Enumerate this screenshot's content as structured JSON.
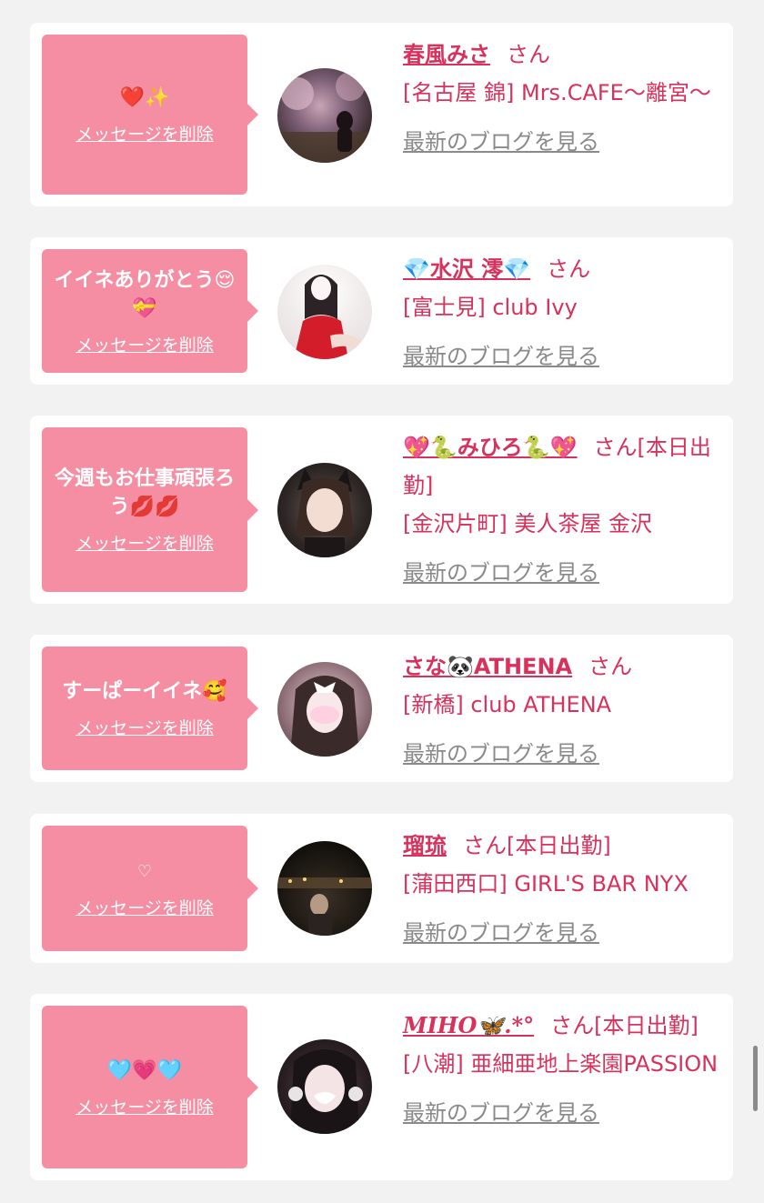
{
  "colors": {
    "page_bg": "#f2f2f2",
    "card_bg": "#ffffff",
    "bubble_bg": "#f58ea3",
    "accent": "#d8325c",
    "link_gray": "#8a8a8a"
  },
  "delete_label": "メッセージを削除",
  "blog_label": "最新のブログを見る",
  "san_label": "さん",
  "cards": [
    {
      "message": "❤️✨",
      "name": "春風みさ",
      "status": "",
      "shop": "[名古屋 錦] Mrs.CAFE～離宮～",
      "avatar_icon": "avatar-cherry-blossom-photo"
    },
    {
      "message": "イイネありがとう😌💝",
      "name": "💎水沢 澪💎",
      "status": "",
      "shop": "[富士見] club Ivy",
      "avatar_icon": "avatar-red-dress-photo"
    },
    {
      "message": "今週もお仕事頑張ろう💋💋",
      "name": "💖🐍みひろ🐍💖",
      "status": "[本日出勤]",
      "shop": "[金沢片町] 美人茶屋 金沢",
      "avatar_icon": "avatar-cat-ears-photo"
    },
    {
      "message": "すーぱーイイネ🥰",
      "name": "さな🐼ATHENA",
      "status": "",
      "shop": "[新橋] club ATHENA",
      "avatar_icon": "avatar-hair-ribbon-photo"
    },
    {
      "message": "♡",
      "name": "瑠琉",
      "status": "[本日出勤]",
      "shop": "[蒲田西口] GIRL'S BAR NYX",
      "avatar_icon": "avatar-night-street-photo"
    },
    {
      "message": "🩵💗🩵",
      "name": "MIHO🦋.*°",
      "status": "[本日出勤]",
      "shop": "[八潮] 亜細亜地上楽園PASSION",
      "avatar_icon": "avatar-selfie-photo"
    }
  ]
}
